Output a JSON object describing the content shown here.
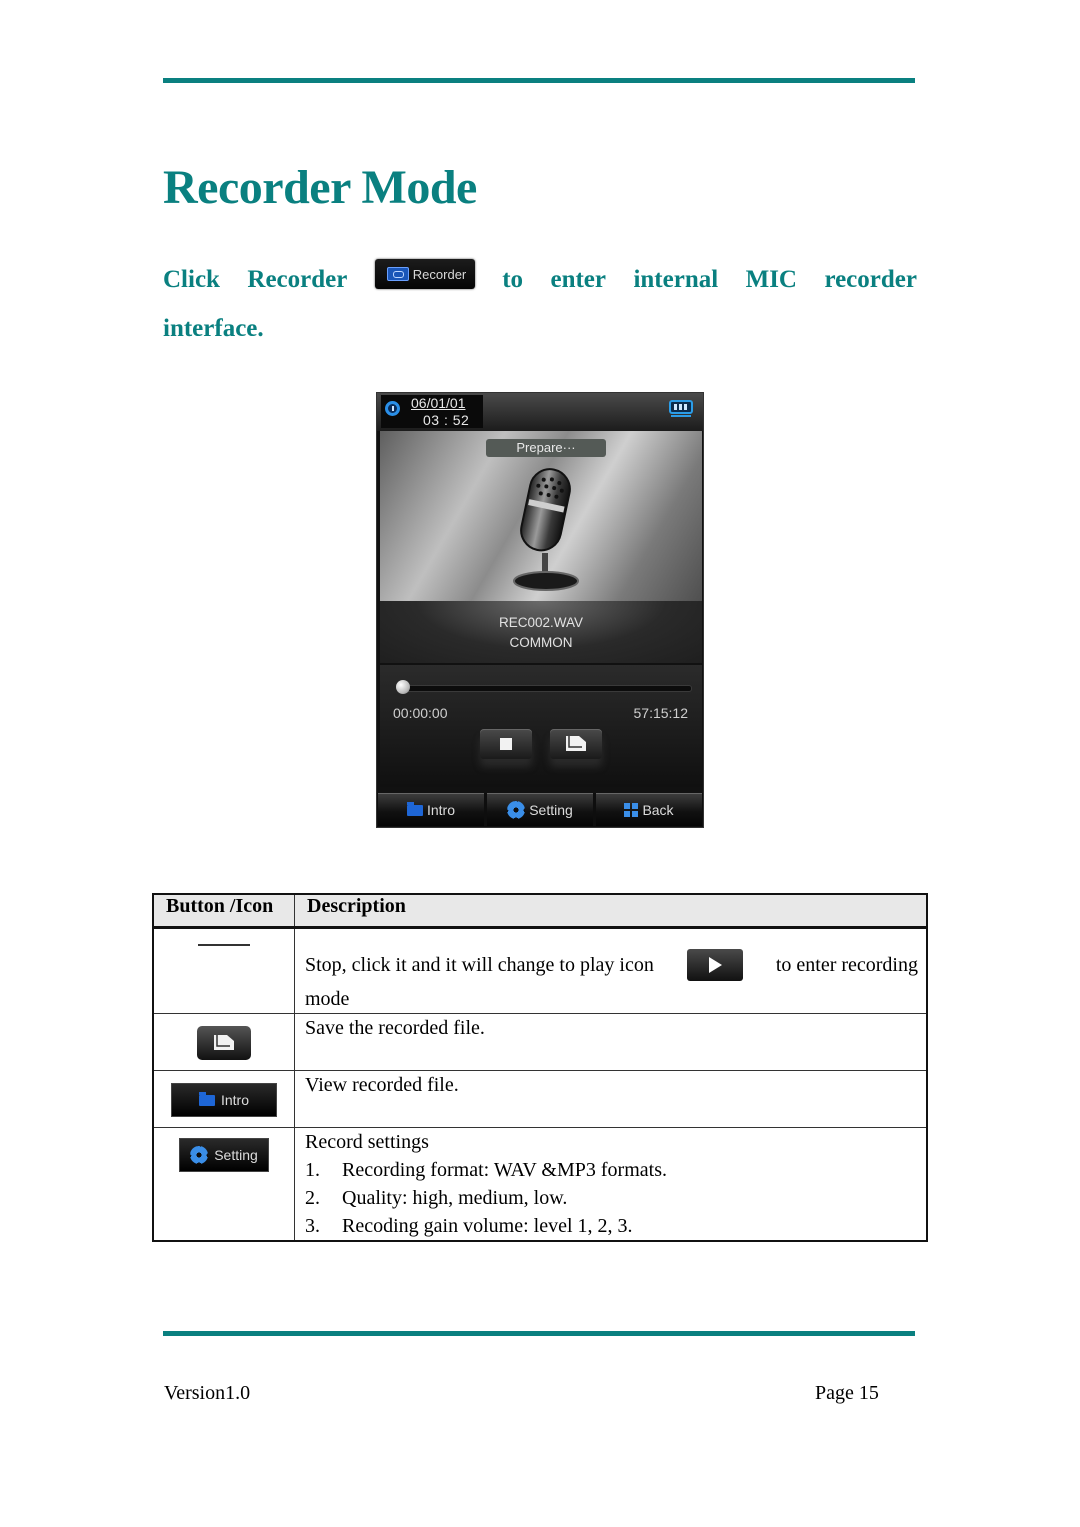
{
  "document": {
    "title": "Recorder Mode",
    "intro": {
      "word_click": "Click",
      "word_recorder": "Recorder",
      "recorder_button_label": "Recorder",
      "words_after": [
        "to",
        "enter",
        "internal",
        "MIC",
        "recorder"
      ],
      "line2": "interface."
    },
    "accent_color": "#0a8080"
  },
  "device": {
    "date": "06/01/01",
    "time": "03 : 52",
    "status": "Prepare···",
    "file_name": "REC002.WAV",
    "folder": "COMMON",
    "progress_fraction": 0.0,
    "elapsed": "00:00:00",
    "remaining": "57:15:12",
    "tabs": [
      {
        "label": "Intro",
        "icon": "folder-icon"
      },
      {
        "label": "Setting",
        "icon": "gear-icon"
      },
      {
        "label": "Back",
        "icon": "grid-icon"
      }
    ]
  },
  "table": {
    "headers": [
      "Button /Icon",
      "Description"
    ],
    "rows": [
      {
        "icon": "stop-icon",
        "text_before": "Stop, click it and it will change to play icon",
        "text_after": "to enter recording",
        "text_line2": "mode"
      },
      {
        "icon": "save-icon",
        "text": "Save the recorded file."
      },
      {
        "icon": "intro-button",
        "icon_label": "Intro",
        "text": "View recorded file."
      },
      {
        "icon": "setting-button",
        "icon_label": "Setting",
        "text": "Record settings",
        "list": [
          {
            "num": "1.",
            "text": "Recording format: WAV &MP3 formats."
          },
          {
            "num": "2.",
            "text": "Quality: high, medium, low."
          },
          {
            "num": "3.",
            "text": "Recoding gain volume: level 1, 2, 3."
          }
        ]
      }
    ]
  },
  "footer": {
    "version": "Version1.0",
    "page": "Page 15"
  }
}
